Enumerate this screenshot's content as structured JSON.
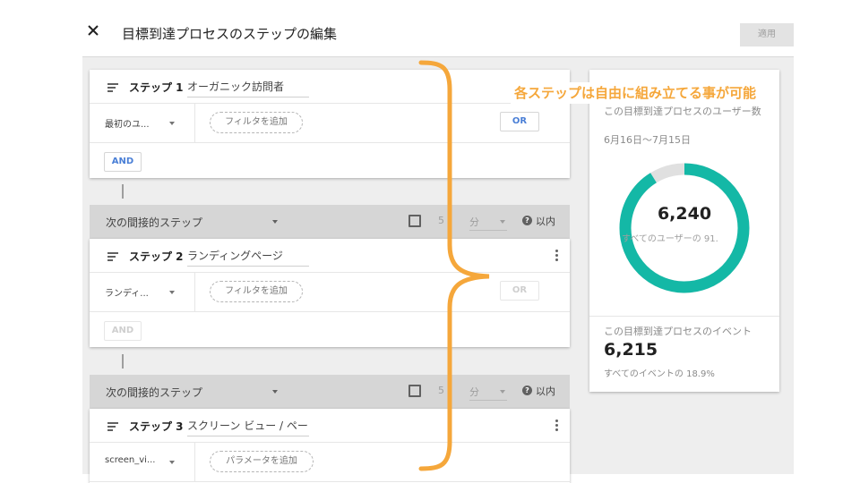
{
  "header": {
    "title": "目標到達プロセスのステップの編集",
    "apply_label": "適用"
  },
  "steps": [
    {
      "label": "ステップ 1",
      "name": "オーガニック訪問者",
      "dimension": "最初のユ...",
      "chip": "フィルタを追加",
      "or_label": "OR",
      "and_label": "AND"
    },
    {
      "label": "ステップ 2",
      "name": "ランディングページ",
      "dimension": "ランディ...",
      "chip": "フィルタを追加",
      "or_label": "OR",
      "and_label": "AND"
    },
    {
      "label": "ステップ 3",
      "name": "スクリーン ビュー / ペー",
      "dimension": "screen_vi...",
      "chip": "パラメータを追加"
    }
  ],
  "next_steps": [
    {
      "label": "次の間接的ステップ",
      "number": "5",
      "unit": "分",
      "within": "以内",
      "help": "?"
    },
    {
      "label": "次の間接的ステップ",
      "number": "5",
      "unit": "分",
      "within": "以内",
      "help": "?"
    }
  ],
  "summary": {
    "users_label": "この目標到達プロセスのユーザー数",
    "date_range": "6月16日～7月15日",
    "users_value": "6,240",
    "users_share_text": "すべてのユーザーの 91.",
    "users_share_fraction": 0.912,
    "events_label": "この目標到達プロセスのイベント",
    "events_value": "6,215",
    "events_share_text": "すべてのイベントの 18.9%"
  },
  "annotation": {
    "text": "各ステップは自由に組み立てる事が可能"
  },
  "colors": {
    "accent_teal": "#14b8a6",
    "donut_track": "#e0e0e0",
    "annotation_orange": "#f5a73b",
    "link_blue": "#4a7fd6"
  }
}
